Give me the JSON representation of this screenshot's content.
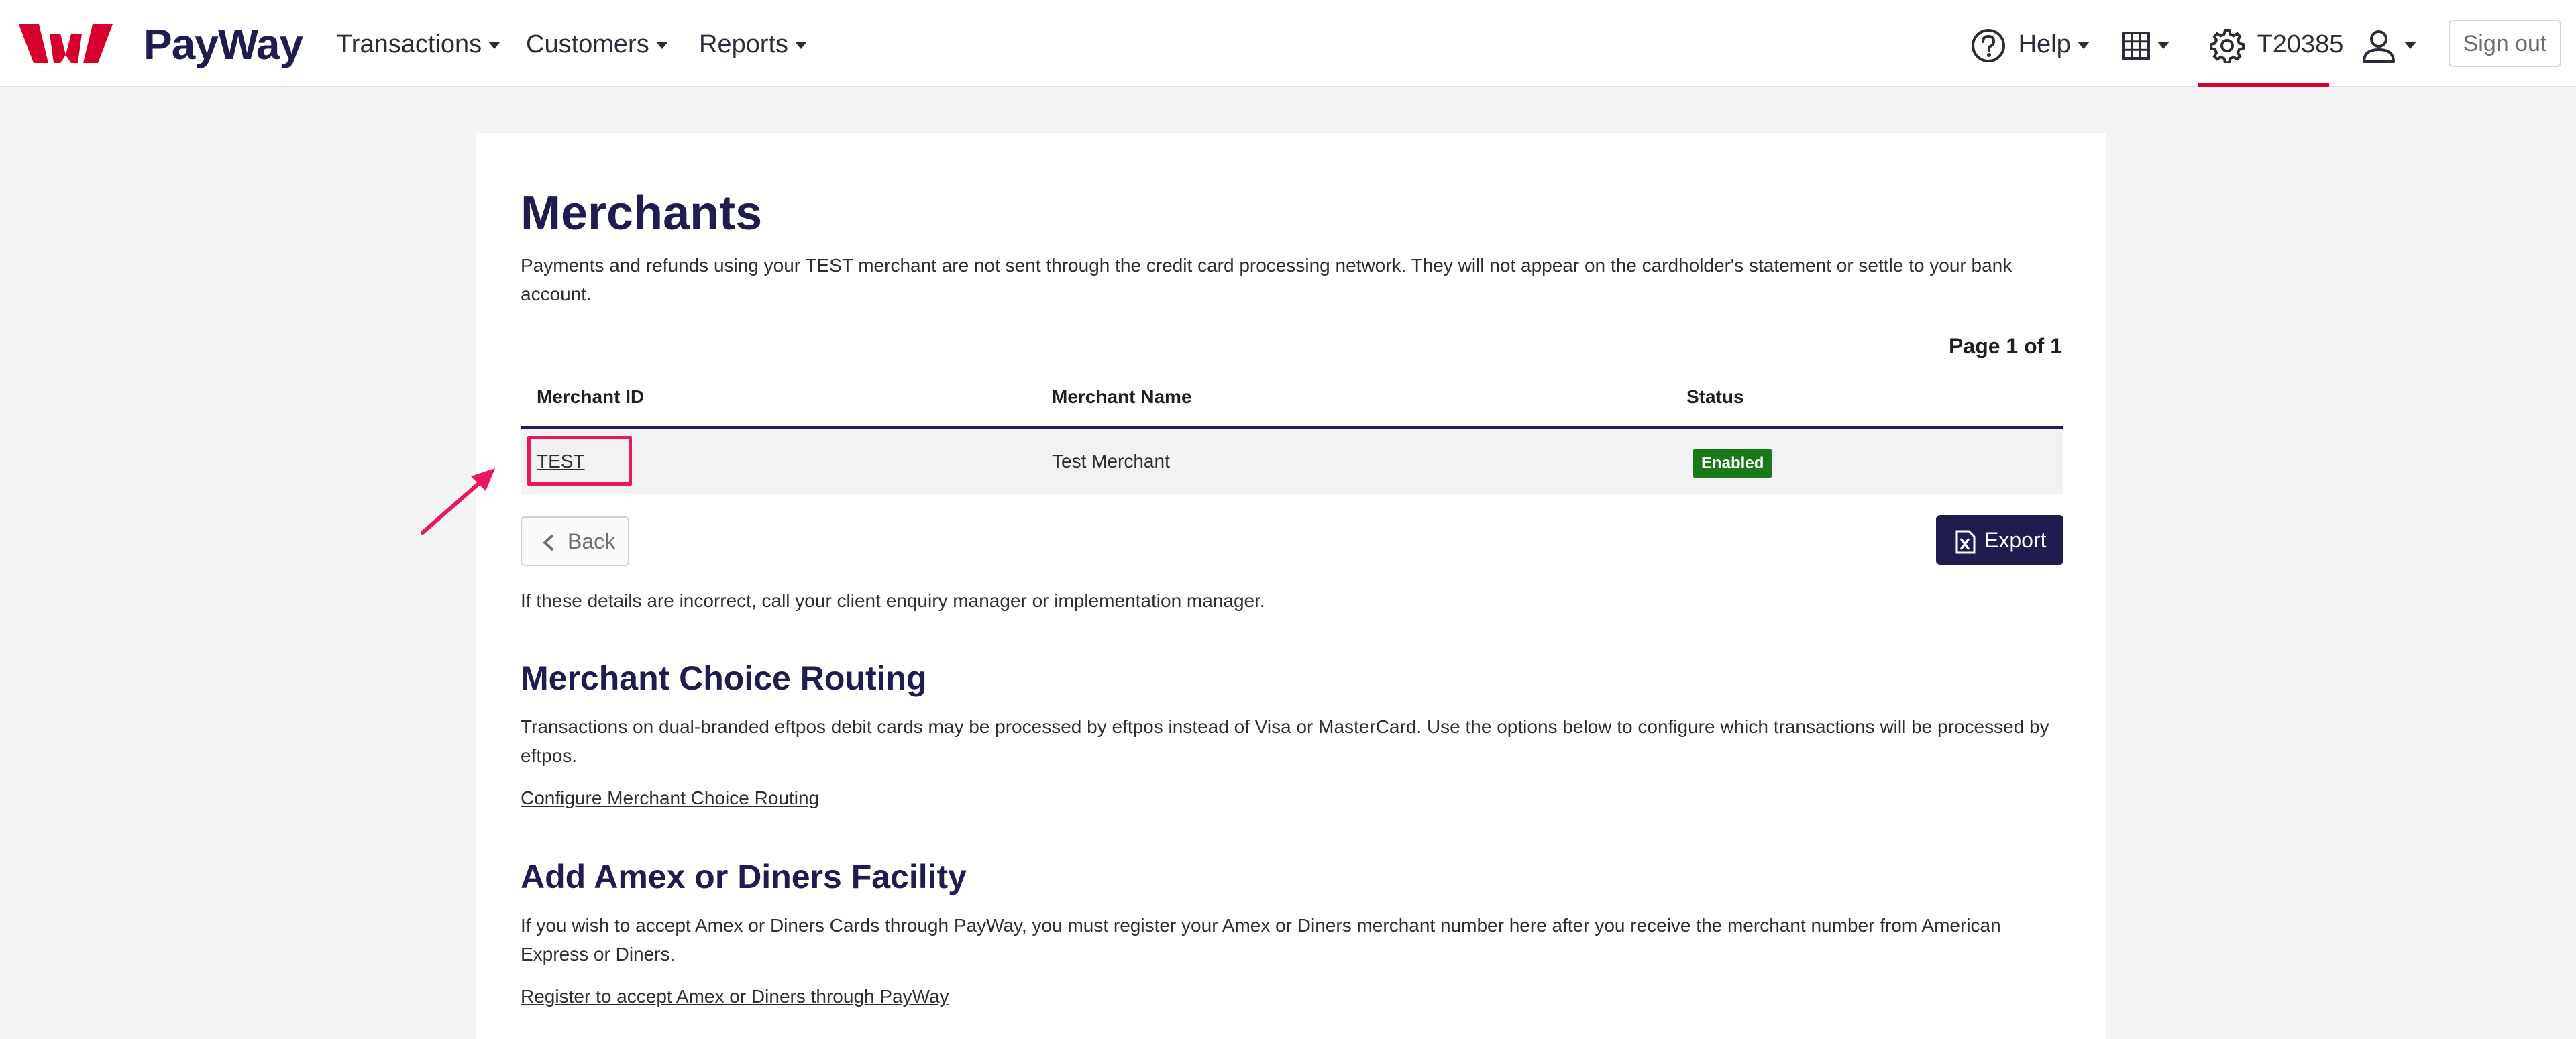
{
  "header": {
    "brand": "PayWay",
    "nav": [
      {
        "label": "Transactions"
      },
      {
        "label": "Customers"
      },
      {
        "label": "Reports"
      }
    ],
    "help_label": "Help",
    "merchant_id_label": "T20385",
    "signout_label": "Sign out",
    "icons": [
      "westpac-logo",
      "help-icon",
      "grid-icon",
      "gear-icon",
      "user-icon"
    ],
    "accent_color": "#d5002b",
    "brand_color": "#1f1c4f"
  },
  "main": {
    "title": "Merchants",
    "intro": "Payments and refunds using your TEST merchant are not sent through the credit card processing network. They will not appear on the cardholder's statement or settle to your bank account.",
    "page_indicator": "Page 1 of 1",
    "table": {
      "columns": [
        "Merchant ID",
        "Merchant Name",
        "Status"
      ],
      "rows": [
        {
          "merchant_id": "TEST",
          "merchant_name": "Test Merchant",
          "status": "Enabled"
        }
      ]
    },
    "back_label": "Back",
    "export_label": "Export",
    "details_note": "If these details are incorrect, call your client enquiry manager or implementation manager.",
    "routing": {
      "heading": "Merchant Choice Routing",
      "text": "Transactions on dual-branded eftpos debit cards may be processed by eftpos instead of Visa or MasterCard. Use the options below to configure which transactions will be processed by eftpos.",
      "link": "Configure Merchant Choice Routing"
    },
    "amex": {
      "heading": "Add Amex or Diners Facility",
      "text": "If you wish to accept Amex or Diners Cards through PayWay, you must register your Amex or Diners merchant number here after you receive the merchant number from American Express or Diners.",
      "link": "Register to accept Amex or Diners through PayWay"
    },
    "status_color": "#1a7a1a",
    "highlight_color": "#e8185a"
  }
}
